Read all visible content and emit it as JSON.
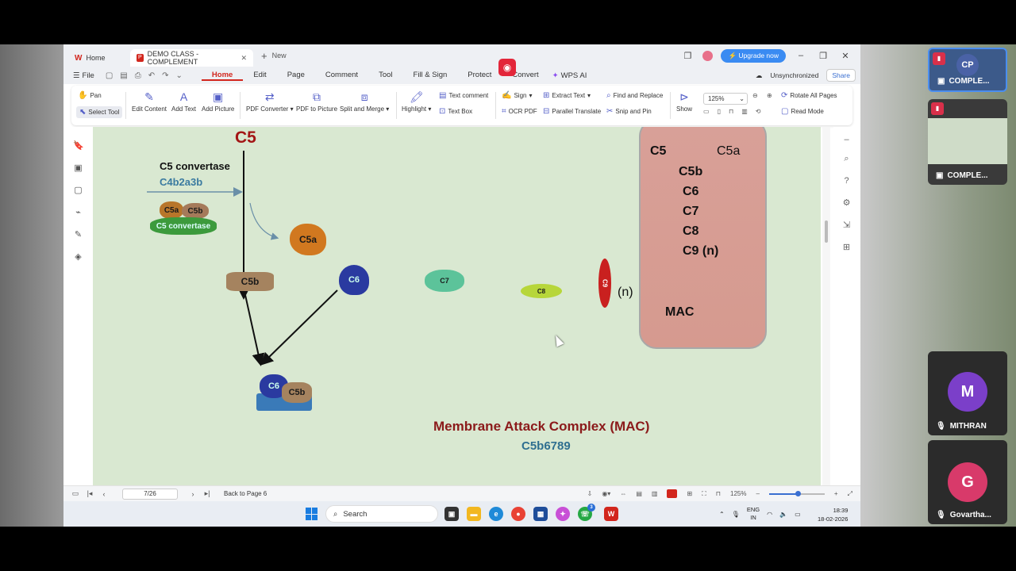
{
  "titlebar": {
    "home_tab": "Home",
    "doc_tab": "DEMO CLASS - COMPLEMENT",
    "new_tab": "New",
    "upgrade": "Upgrade now"
  },
  "menubar": {
    "file": "File",
    "items": [
      "Home",
      "Edit",
      "Page",
      "Comment",
      "Tool",
      "Fill & Sign",
      "Protect",
      "Convert"
    ],
    "wps_ai": "WPS AI",
    "sync_status": "Unsynchronized",
    "share": "Share"
  },
  "ribbon": {
    "pan": "Pan",
    "select_tool": "Select Tool",
    "edit_content": "Edit Content",
    "add_text": "Add Text",
    "add_picture": "Add Picture",
    "pdf_converter": "PDF Converter",
    "pdf_to_picture": "PDF to Picture",
    "split_merge": "Split and Merge",
    "highlight": "Highlight",
    "text_comment": "Text comment",
    "text_box": "Text Box",
    "sign": "Sign",
    "ocr_pdf": "OCR PDF",
    "extract_text": "Extract Text",
    "parallel_translate": "Parallel Translate",
    "find_replace": "Find and Replace",
    "snip_pin": "Snip and Pin",
    "show": "Show",
    "zoom": "125%",
    "rotate_all": "Rotate All Pages",
    "read_mode": "Read Mode"
  },
  "slide": {
    "c5": "C5",
    "convertase_label": "C5 convertase",
    "convertase_formula": "C4b2a3b",
    "blob_c5a_small": "C5a",
    "blob_c5b_small": "C5b",
    "blob_c5_convertase": "C5 convertase",
    "blob_c5a": "C5a",
    "blob_c5b": "C5b",
    "blob_c6": "C6",
    "blob_c7": "C7",
    "blob_c8": "C8",
    "blob_c9": "C9",
    "n_label": "(n)",
    "blob_c6_complex": "C6",
    "blob_c5b_complex": "C5b",
    "panel": {
      "c5": "C5",
      "c5a": "C5a",
      "items": [
        "C5b",
        "C6",
        "C7",
        "C8",
        "C9 (n)"
      ],
      "mac": "MAC"
    },
    "mac_title": "Membrane Attack Complex   (MAC)",
    "mac_formula": "C5b6789"
  },
  "statusbar": {
    "page": "7/26",
    "back": "Back to Page 6",
    "zoom": "125%"
  },
  "taskbar": {
    "search": "Search",
    "lang_top": "ENG",
    "lang_bottom": "IN",
    "time": "18:39",
    "date": "18-02-2026",
    "whatsapp_badge": "3"
  },
  "meeting": {
    "tile1_initials": "CP",
    "tile1_name": "COMPLE...",
    "tile2_name": "COMPLE...",
    "tile3_initial": "M",
    "tile3_name": "MITHRAN",
    "tile4_initial": "G",
    "tile4_name": "Govartha..."
  },
  "colors": {
    "accent": "#d2261d",
    "slide_bg": "#d9e8d1",
    "title_red": "#a31515",
    "formula_blue": "#3a7aa0",
    "upgrade_blue": "#3a8bf2"
  }
}
